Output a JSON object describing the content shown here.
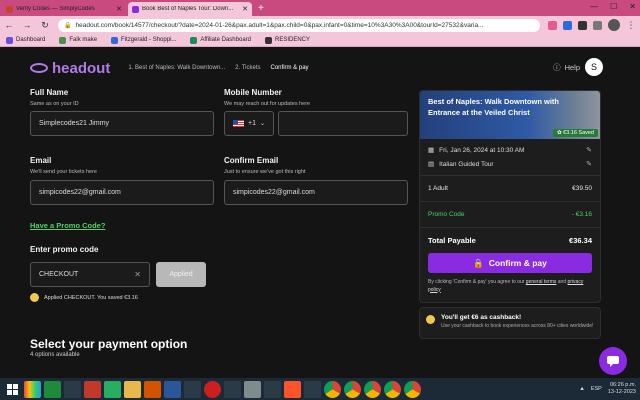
{
  "browser": {
    "tabs": [
      {
        "title": "Verify Codes — SimplyCodes",
        "active": false,
        "favicon_color": "#c7442b"
      },
      {
        "title": "Book Best of Naples Tour: Down...",
        "active": true,
        "favicon_color": "#8a2be2"
      }
    ],
    "url": "headout.com/book/14577/checkout/?date=2024-01-26&pax.adult=1&pax.child=0&pax.infant=0&time=10%3A30%3A00&tourId=27532&varia...",
    "bookmarks": [
      {
        "label": "Dashboard",
        "color": "#6b4de6"
      },
      {
        "label": "Falk make",
        "color": "#4a8f4a"
      },
      {
        "label": "Fitzgerald - Shoppi...",
        "color": "#2f6bd8"
      },
      {
        "label": "Affiliate Dashboard",
        "color": "#1f8a5a"
      },
      {
        "label": "RESIDENCY",
        "color": "#333333"
      }
    ]
  },
  "header": {
    "logo": "headout",
    "breadcrumbs": [
      "1. Best of Naples: Walk Downtown...",
      "2. Tickets",
      "Confirm & pay"
    ],
    "help": "Help",
    "avatar_letter": "S"
  },
  "form": {
    "full_name_label": "Full Name",
    "full_name_sub": "Same as on your ID",
    "full_name_value": "Simplecodes21 Jimmy",
    "mobile_label": "Mobile Number",
    "mobile_sub": "We may reach out for updates here",
    "country_code": "+1",
    "email_label": "Email",
    "email_sub": "We'll send your tickets here",
    "email_value": "simpicodes22@gmail.com",
    "confirm_email_label": "Confirm Email",
    "confirm_email_sub": "Just to ensure we've got this right",
    "confirm_email_value": "simpicodes22@gmail.com",
    "promo_link": "Have a Promo Code?",
    "promo_label": "Enter promo code",
    "promo_value": "CHECKOUT",
    "applied_button": "Applied",
    "applied_message": "Applied CHECKOUT. You saved €3.16"
  },
  "payment": {
    "title": "Select your payment option",
    "subtitle": "4 options available"
  },
  "summary": {
    "title": "Best of Naples: Walk Downtown with Entrance at the Veiled Christ",
    "saved_badge": "€3.16 Saved",
    "date_time": "Fri, Jan 26, 2024 at 10:30 AM",
    "tour_type": "Italian Guided Tour",
    "adult_label": "1 Adult",
    "adult_price": "€39.50",
    "promo_label": "Promo Code",
    "promo_value": "- €3.16",
    "total_label": "Total Payable",
    "total_value": "€36.34",
    "confirm_button": "Confirm & pay",
    "terms_prefix": "By clicking 'Confirm & pay' you agree to our ",
    "terms_link": "general terms",
    "terms_and": " and ",
    "privacy_link": "privacy policy"
  },
  "cashback": {
    "title": "You'll get €6 as cashback!",
    "desc": "Use your cashback to book experiences across 80+ cities worldwide!"
  },
  "taskbar": {
    "time": "06:26 p.m.",
    "date": "13-12-2023",
    "lang": "ESP"
  }
}
